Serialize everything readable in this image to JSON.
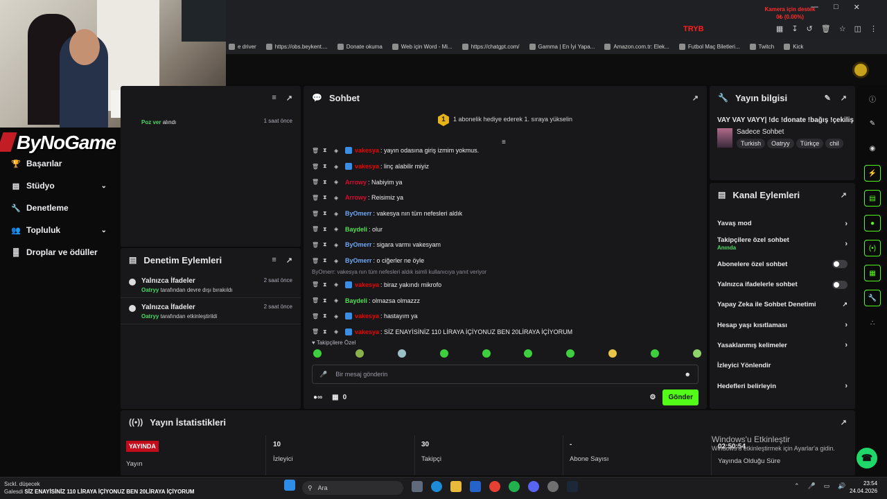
{
  "browser": {
    "camera_note_line1": "Kamera için destek",
    "camera_note_line2": "0₺ (0.00%)",
    "tryb_label": "TRYB",
    "bookmarks": [
      "e driver",
      "https://obs.beykent....",
      "Donate okuma",
      "Web için Word - Mi...",
      "https://chatgpt.com/",
      "Gamma | En İyi Yapa...",
      "Amazon.com.tr: Elek...",
      "Futbol Maç Biletleri...",
      "Twitch",
      "Kick"
    ]
  },
  "logo_text": "ByNoGame",
  "nav": {
    "items": [
      {
        "label": "Başarılar",
        "icon": "trophy-icon"
      },
      {
        "label": "Stüdyo",
        "icon": "studio-icon"
      },
      {
        "label": "Denetleme",
        "icon": "wrench-icon"
      },
      {
        "label": "Topluluk",
        "icon": "users-icon"
      },
      {
        "label": "Droplar ve ödüller",
        "icon": "drops-icon"
      }
    ]
  },
  "activity": {
    "event_text": "Poz ver",
    "event_suffix": " alındı",
    "event_time": "1 saat önce"
  },
  "mod_actions": {
    "title": "Denetim Eylemleri",
    "rows": [
      {
        "title": "Yalnızca İfadeler",
        "user": "Oatryy",
        "desc": " tarafından devre dışı bırakıldı",
        "time": "2 saat önce"
      },
      {
        "title": "Yalnızca İfadeler",
        "user": "Oatryy",
        "desc": " tarafından etkinleştirildi",
        "time": "2 saat önce"
      }
    ]
  },
  "chat": {
    "title": "Sohbet",
    "pinned_count": "1",
    "pinned": "1 abonelik hediye ederek 1. sıraya yükselin",
    "messages": [
      {
        "user": "vakesya",
        "color": "#eb0400",
        "badge": "#3a8ee6",
        "text": ": yayın odasına giriş izmim yokmus."
      },
      {
        "user": "vakesya",
        "color": "#eb0400",
        "badge": "#3a8ee6",
        "text": ": linç alabilir miyiz"
      },
      {
        "user": "Arrowy",
        "color": "#d80b2e",
        "badge": "",
        "text": ": Nabiyim ya"
      },
      {
        "user": "Arrowy",
        "color": "#d80b2e",
        "badge": "",
        "text": ": Reisimiz ya"
      },
      {
        "user": "ByOmerr",
        "color": "#6fa8f5",
        "badge": "",
        "text": ": vakesya nın tüm nefesleri aldık"
      },
      {
        "user": "Baydeli",
        "color": "#52e052",
        "badge": "",
        "text": ": olur"
      },
      {
        "user": "ByOmerr",
        "color": "#6fa8f5",
        "badge": "",
        "text": ": sigara varmı vakesyam"
      },
      {
        "user": "ByOmerr",
        "color": "#6fa8f5",
        "badge": "",
        "text": ": o ciğerler ne öyle"
      },
      {
        "user": "vakesya",
        "color": "#eb0400",
        "badge": "#3a8ee6",
        "text": ": biraz yakındı mikrofo"
      },
      {
        "user": "Baydeli",
        "color": "#52e052",
        "badge": "",
        "text": ": olmazsa olmazzz"
      },
      {
        "user": "vakesya",
        "color": "#eb0400",
        "badge": "#3a8ee6",
        "text": ": hastayım ya"
      },
      {
        "user": "vakesya",
        "color": "#eb0400",
        "badge": "#3a8ee6",
        "text": ": SİZ ENAYİSİNİZ 110 LİRAYA İÇİYONUZ BEN 20LİRAYA İÇİYORUM"
      }
    ],
    "reply_hint": "ByOmerr: vakesya nın tüm nefesleri aldık isimli kullanıcıya yanıt veriyor",
    "followers_only": "Takipçilere Özel",
    "input_placeholder": "Bir mesaj gönderin",
    "points": "0",
    "send_label": "Gönder"
  },
  "stream_info": {
    "title": "Yayın bilgisi",
    "stream_title": "VAY VAY VAYY| !dc !donate !bağış !çekiliş",
    "category": "Sadece Sohbet",
    "tags": [
      "Turkish",
      "Oatryy",
      "Türkçe",
      "chil"
    ]
  },
  "channel_actions": {
    "title": "Kanal Eylemleri",
    "items": [
      {
        "label": "Yavaş mod",
        "sub": "",
        "control": "chevron"
      },
      {
        "label": "Takipçilere özel sohbet",
        "sub": "Anında",
        "control": "chevron"
      },
      {
        "label": "Abonelere özel sohbet",
        "sub": "",
        "control": "toggle"
      },
      {
        "label": "Yalnızca ifadelerle sohbet",
        "sub": "",
        "control": "toggle"
      },
      {
        "label": "Yapay Zeka ile Sohbet Denetimi",
        "sub": "",
        "control": "external"
      },
      {
        "label": "Hesap yaşı kısıtlaması",
        "sub": "",
        "control": "chevron"
      },
      {
        "label": "Yasaklanmış kelimeler",
        "sub": "",
        "control": "chevron"
      },
      {
        "label": "İzleyici Yönlendir",
        "sub": "",
        "control": "none"
      },
      {
        "label": "Hedefleri belirleyin",
        "sub": "",
        "control": "chevron"
      }
    ]
  },
  "stats": {
    "title": "Yayın İstatistikleri",
    "live_label": "YAYINDA",
    "items": [
      {
        "value": "",
        "label": "Yayın"
      },
      {
        "value": "10",
        "label": "İzleyici"
      },
      {
        "value": "30",
        "label": "Takipçi"
      },
      {
        "value": "-",
        "label": "Abone Sayısı"
      },
      {
        "value": "02:50:54",
        "label": "Yayında Olduğu Süre"
      }
    ]
  },
  "windows_activation": {
    "line1": "Windows'u Etkinleştir",
    "line2": "Windows'u etkinleştirmek için Ayarlar'a gidin."
  },
  "taskbar": {
    "note_line1": "Sıckl. düşecek",
    "note_line2_prefix": "Galesdi",
    "note_ticker": "SİZ ENAYİSİNİZ 110 LİRAYA İÇİYONUZ BEN 20LİRAYA İÇİYORUM",
    "search_placeholder": "Ara",
    "time": "23:54",
    "date": "24.04.2026"
  },
  "colors": {
    "accent": "#53fc18",
    "live": "#c20c1c"
  }
}
